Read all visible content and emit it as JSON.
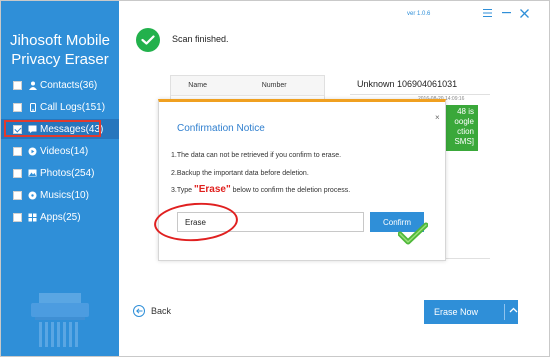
{
  "app": {
    "title_line1": "Jihosoft Mobile",
    "title_line2": "Privacy Eraser",
    "version": "ver 1.0.6"
  },
  "sidebar": {
    "items": [
      {
        "label": "Contacts(36)",
        "icon": "contacts-icon",
        "checked": false
      },
      {
        "label": "Call Logs(151)",
        "icon": "phone-icon",
        "checked": false
      },
      {
        "label": "Messages(43)",
        "icon": "message-icon",
        "checked": true
      },
      {
        "label": "Videos(14)",
        "icon": "video-icon",
        "checked": false
      },
      {
        "label": "Photos(254)",
        "icon": "photo-icon",
        "checked": false
      },
      {
        "label": "Musics(10)",
        "icon": "music-icon",
        "checked": false
      },
      {
        "label": "Apps(25)",
        "icon": "apps-icon",
        "checked": false
      }
    ]
  },
  "scan": {
    "status": "Scan finished."
  },
  "table": {
    "columns": [
      "Name",
      "Number"
    ]
  },
  "message_panel": {
    "sender": "Unknown 106904061031",
    "timestamp": "2016-08-20 14:09:16",
    "bubble_lines": [
      "48 is",
      "oogle",
      "ction",
      "SMS]"
    ]
  },
  "dialog": {
    "title": "Confirmation Notice",
    "line1": "1.The data can not be retrieved if you confirm to erase.",
    "line2": "2.Backup the important data before deletion.",
    "line3_prefix": "3.Type ",
    "line3_keyword": "\"Erase\"",
    "line3_suffix": " below to confirm the deletion process.",
    "input_value": "Erase",
    "confirm_label": "Confirm",
    "close_label": "×"
  },
  "footer": {
    "back_label": "Back",
    "erase_now_label": "Erase Now"
  },
  "colors": {
    "sidebar": "#2f8fd8",
    "accent": "#2f8fd8",
    "highlight_red": "#e23a2d",
    "success_green": "#22b14c",
    "dialog_top": "#f0a020"
  }
}
